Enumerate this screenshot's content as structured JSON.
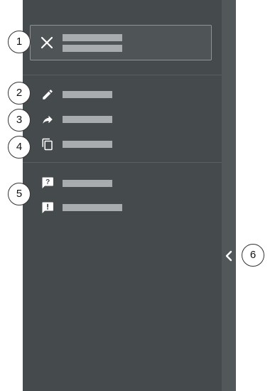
{
  "callouts": [
    "1",
    "2",
    "3",
    "4",
    "5",
    "6"
  ],
  "icons": {
    "close": "close-icon",
    "edit": "pencil-icon",
    "share": "share-arrow-icon",
    "copy": "copy-icon",
    "help": "help-chat-icon",
    "report": "report-chat-icon",
    "collapse": "chevron-left-icon"
  },
  "colors": {
    "panel": "#454a4d",
    "rail": "#525759",
    "placeholder": "#a9acae",
    "icon": "#ffffff"
  }
}
